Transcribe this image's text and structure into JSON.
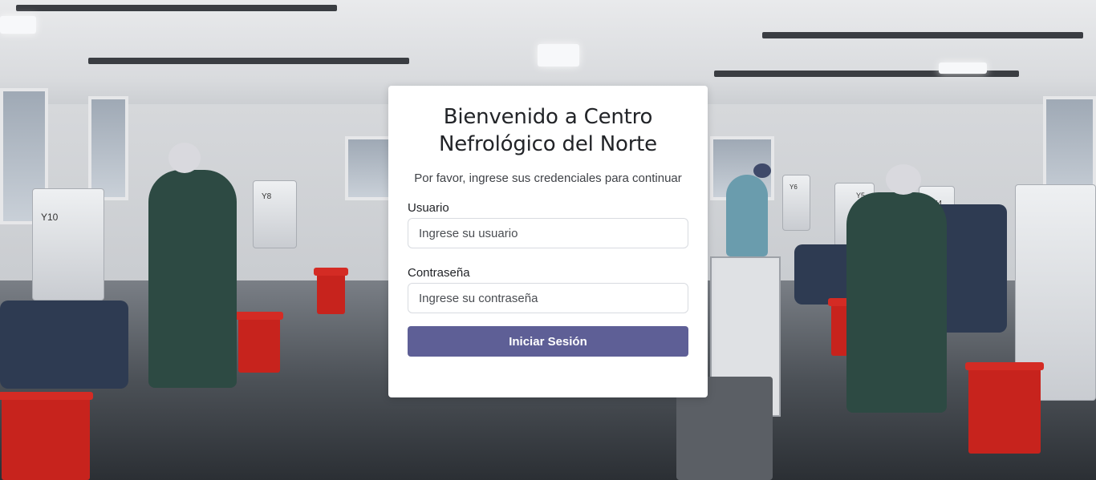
{
  "login": {
    "title": "Bienvenido a Centro Nefrológico del Norte",
    "subtitle": "Por favor, ingrese sus credenciales para continuar",
    "username": {
      "label": "Usuario",
      "placeholder": "Ingrese su usuario",
      "value": ""
    },
    "password": {
      "label": "Contraseña",
      "placeholder": "Ingrese su contraseña",
      "value": ""
    },
    "submit_label": "Iniciar Sesión"
  },
  "colors": {
    "button": "#5e5f96",
    "card_background": "#ffffff"
  },
  "background": {
    "machine_labels": [
      "Y10",
      "Y8",
      "Y6",
      "Y5",
      "Y4"
    ]
  }
}
